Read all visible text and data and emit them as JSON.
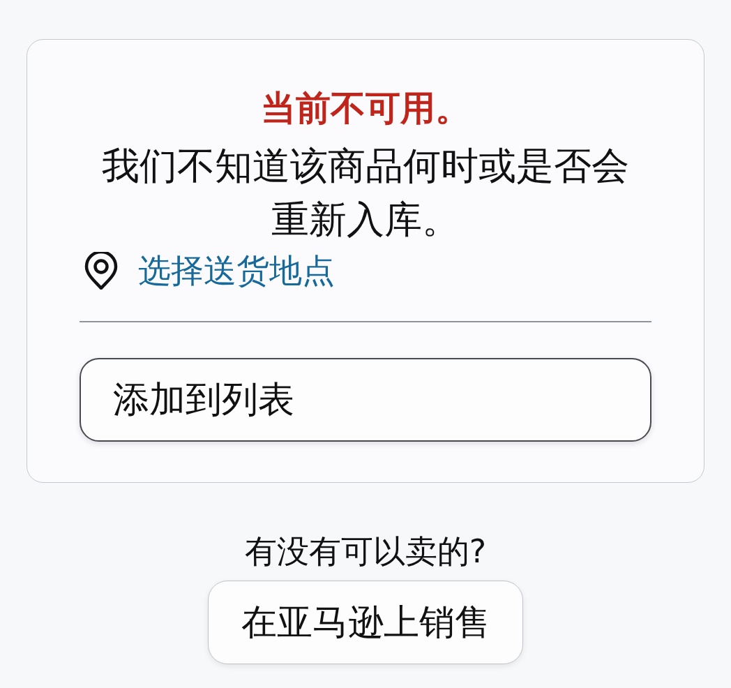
{
  "availability": {
    "status": "当前不可用。",
    "message": "我们不知道该商品何时或是否会重新入库。"
  },
  "delivery_location": {
    "link": "选择送货地点"
  },
  "add_to_list_button": {
    "label": "添加到列表"
  },
  "sell_prompt": {
    "question": "有没有可以卖的?",
    "button": "在亚马逊上销售"
  }
}
